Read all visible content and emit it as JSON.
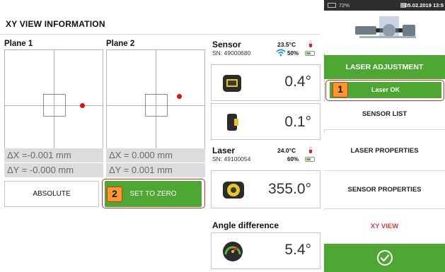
{
  "header": {
    "title": "XY VIEW INFORMATION"
  },
  "planes": [
    {
      "label": "Plane 1",
      "dx": "ΔX =-0.001 mm",
      "dy": "ΔY = -0.000 mm"
    },
    {
      "label": "Plane 2",
      "dx": "ΔX =  0.000 mm",
      "dy": "ΔY =  0.001 mm"
    }
  ],
  "buttons": {
    "absolute": "ABSOLUTE",
    "set_to_zero": "SET TO ZERO"
  },
  "callouts": {
    "one": "1",
    "two": "2"
  },
  "sensor": {
    "label": "Sensor",
    "sn": "SN: 49000680",
    "temp": "23.5°C",
    "battery": "50%",
    "angle1": "0.4°",
    "angle2": "0.1°"
  },
  "laser": {
    "label": "Laser",
    "sn": "SN: 49100054",
    "temp": "24.0°C",
    "battery": "60%",
    "angle": "355.0°"
  },
  "angle_difference": {
    "label": "Angle difference",
    "value": "5.4°"
  },
  "status_bar": {
    "battery": "72%",
    "date_time": "05.02.2019 13:5"
  },
  "nav": {
    "laser_adjustment": "LASER ADJUSTMENT",
    "laser_ok": "Laser OK",
    "sensor_list": "SENSOR LIST",
    "laser_properties": "LASER PROPERTIES",
    "sensor_properties": "SENSOR PROPERTIES",
    "xy_view": "XY VIEW"
  },
  "icons": {
    "wifi": "wifi-icon",
    "thermometer": "thermometer-icon",
    "battery": "battery-icon",
    "sensor": "sensor-device-icon",
    "laser": "laser-device-icon",
    "gauge": "gauge-icon",
    "confirm": "checkmark-icon"
  },
  "colors": {
    "accent": "#4ea633",
    "highlight": "#d62b2b",
    "callout": "#ff9a2a",
    "target_dot": "#e10f0f",
    "active_nav_text": "#e23a3a"
  }
}
